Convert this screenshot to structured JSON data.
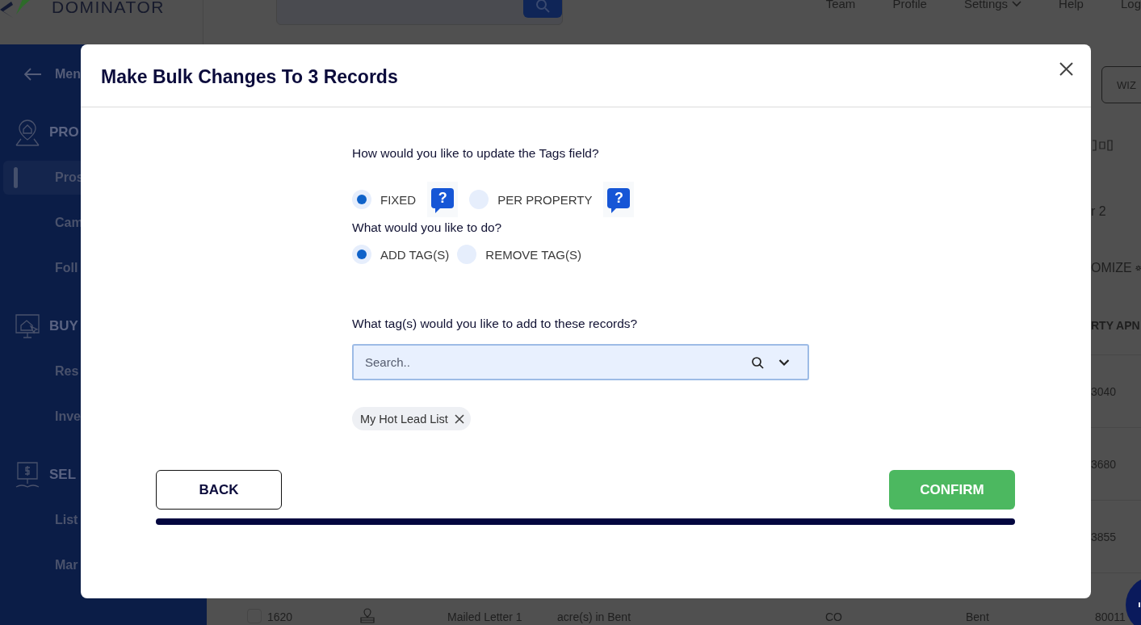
{
  "header": {
    "logo_text": "DOMINATOR",
    "nav": [
      {
        "label": "Team",
        "kind": "link"
      },
      {
        "label": "Profile",
        "kind": "link"
      },
      {
        "label": "Settings",
        "kind": "dropdown"
      },
      {
        "label": "Help",
        "kind": "link"
      },
      {
        "label": "Log",
        "kind": "link"
      }
    ]
  },
  "sidebar": {
    "back_label": "Men",
    "sections": [
      {
        "title": "PRO",
        "kind": "prospect",
        "items": [
          {
            "label": "Pros",
            "selected": true
          },
          {
            "label": "Cam",
            "selected": false
          },
          {
            "label": "Foll",
            "selected": false
          }
        ]
      },
      {
        "title": "BUY",
        "kind": "buyer",
        "items": [
          {
            "label": "Res",
            "selected": false
          },
          {
            "label": "Inve",
            "selected": false
          }
        ]
      },
      {
        "title": "SEL",
        "kind": "seller",
        "items": [
          {
            "label": "List",
            "selected": false
          },
          {
            "label": "Mar",
            "selected": false
          }
        ]
      }
    ]
  },
  "main": {
    "wizard_button": "WIZ",
    "filter_text": "r 2",
    "customize_label": "OMIZE",
    "column_header": "RTY APN",
    "cells": [
      "3040",
      "3680",
      "3855"
    ],
    "bottom_row": {
      "checked": false,
      "id": "1620",
      "campaign": "Mailed Letter 1",
      "description": "acre(s) in Bent",
      "state": "CO",
      "county": "Bent",
      "apn": "80011"
    }
  },
  "modal": {
    "title": "Make Bulk Changes To 3 Records",
    "update_mode": {
      "question": "How would you like to update the Tags field?",
      "options": [
        {
          "label": "FIXED",
          "selected": true,
          "help": "?"
        },
        {
          "label": "PER PROPERTY",
          "selected": false,
          "help": "?"
        }
      ]
    },
    "action": {
      "question": "What would you like to do?",
      "options": [
        {
          "label": "ADD TAG(S)",
          "selected": true
        },
        {
          "label": "REMOVE TAG(S)",
          "selected": false
        }
      ]
    },
    "tags": {
      "question": "What tag(s) would you like to add to these records?",
      "search": {
        "placeholder": "Search.."
      },
      "chips": [
        {
          "label": "My Hot Lead List"
        }
      ]
    },
    "buttons": [
      {
        "label": "BACK",
        "kind": "secondary"
      },
      {
        "label": "CONFIRM",
        "kind": "primary"
      }
    ],
    "progress": {
      "level": 1
    }
  }
}
